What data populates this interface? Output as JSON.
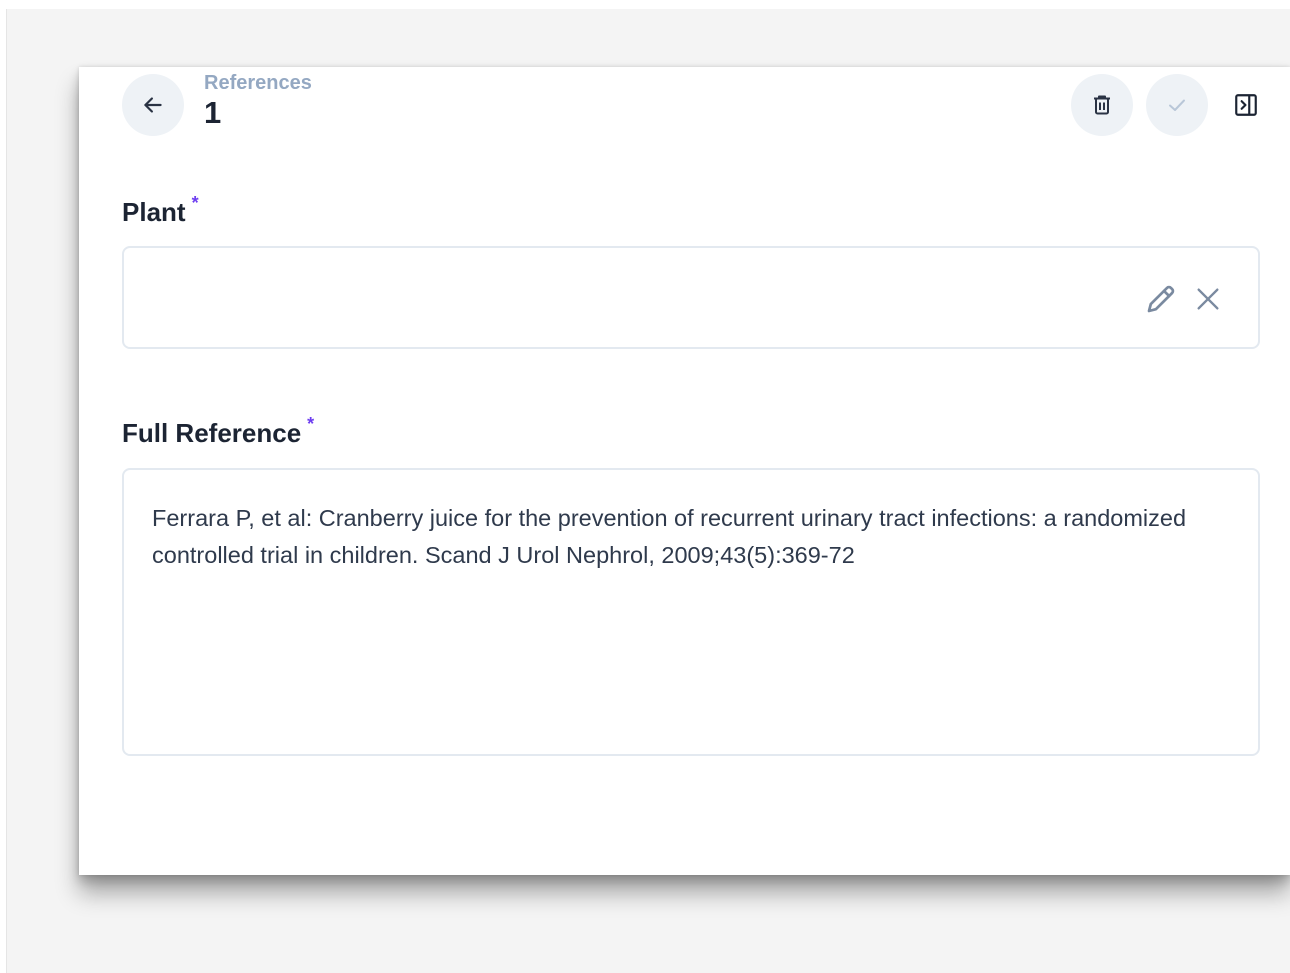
{
  "header": {
    "breadcrumb": "References",
    "record_title": "1"
  },
  "icons": {
    "back": "arrow-left-icon",
    "delete": "trash-icon",
    "save": "check-icon",
    "panel": "panel-toggle-icon",
    "edit": "pencil-icon",
    "clear": "close-icon"
  },
  "colors": {
    "required_marker": "#6d3df0",
    "breadcrumb": "#94a8c2",
    "title": "#1c2433",
    "button_bg": "#eef2f6"
  },
  "fields": {
    "plant": {
      "label": "Plant",
      "required_mark": "*",
      "value": ""
    },
    "full_reference": {
      "label": "Full Reference",
      "required_mark": "*",
      "value": "Ferrara P, et al: Cranberry juice for the prevention of recurrent urinary tract infections: a randomized controlled trial in children. Scand J Urol Nephrol, 2009;43(5):369-72"
    }
  }
}
